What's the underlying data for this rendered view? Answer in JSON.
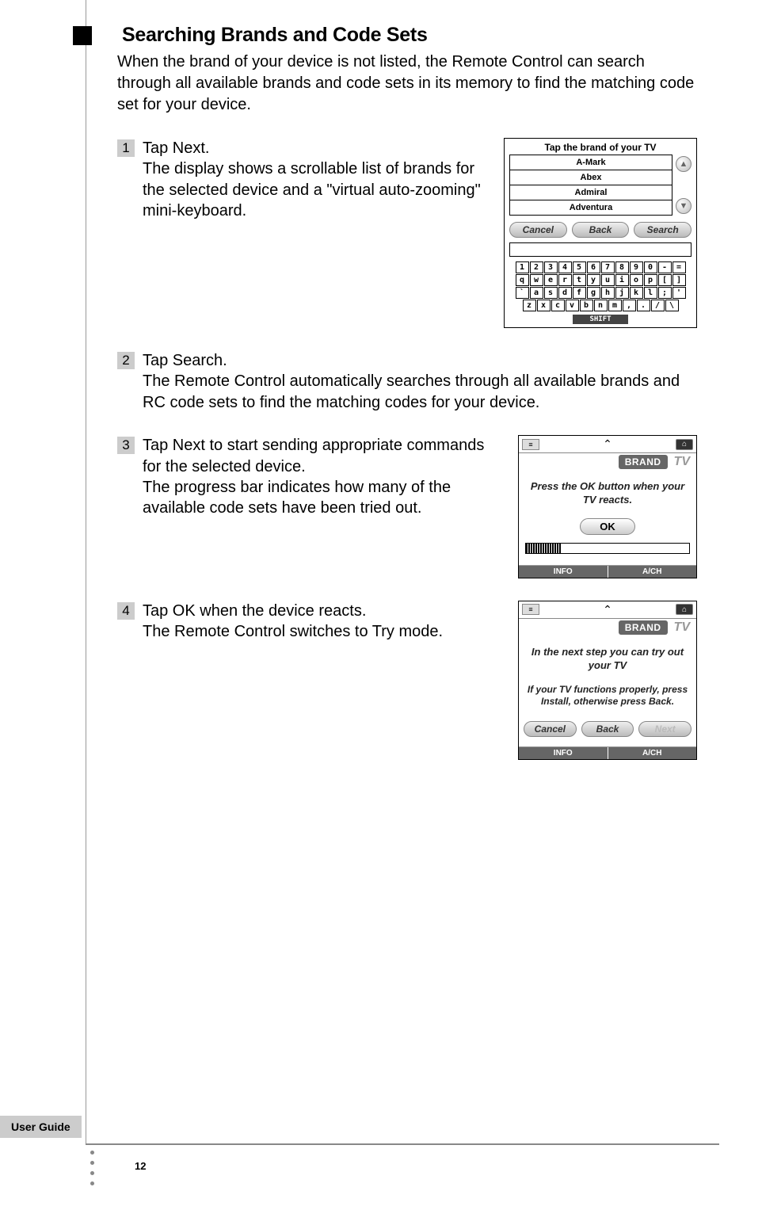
{
  "page": {
    "heading": "Searching Brands and Code Sets",
    "intro": "When the brand of your device is not listed, the Remote Control can search through all available brands and code sets in its memory to find the matching code set for your device.",
    "footer_label": "User Guide",
    "page_number": "12"
  },
  "steps": [
    {
      "num": "1",
      "title": "Tap Next.",
      "body": "The display shows a scrollable list of brands for the selected device and a \"virtual auto-zooming\" mini-keyboard."
    },
    {
      "num": "2",
      "title": "Tap Search.",
      "body": "The Remote Control automatically searches through all available brands and RC code sets to find the matching codes for your device."
    },
    {
      "num": "3",
      "title": "Tap Next to start sending appropriate commands for the selected device.",
      "body": "The progress bar indicates how many of the available code sets have been tried out."
    },
    {
      "num": "4",
      "title": "Tap OK when the device reacts.",
      "body": "The Remote Control switches to Try mode."
    }
  ],
  "screen1": {
    "title": "Tap the brand of your TV",
    "brands": [
      "A-Mark",
      "Abex",
      "Admiral",
      "Adventura"
    ],
    "buttons": {
      "cancel": "Cancel",
      "back": "Back",
      "search": "Search"
    },
    "shift": "SHIFT",
    "kbd": {
      "row1": [
        "1",
        "2",
        "3",
        "4",
        "5",
        "6",
        "7",
        "8",
        "9",
        "0",
        "-",
        "="
      ],
      "row2": [
        "q",
        "w",
        "e",
        "r",
        "t",
        "y",
        "u",
        "i",
        "o",
        "p",
        "[",
        "]"
      ],
      "row3": [
        "`",
        "a",
        "s",
        "d",
        "f",
        "g",
        "h",
        "j",
        "k",
        "l",
        ";",
        "'"
      ],
      "row4": [
        "z",
        "x",
        "c",
        "v",
        "b",
        "n",
        "m",
        ",",
        ".",
        "/",
        "\\"
      ]
    }
  },
  "screen2": {
    "brand_tab": "BRAND",
    "tv_tab": "TV",
    "message": "Press the OK button when your TV reacts.",
    "ok": "OK",
    "bottom": {
      "info": "INFO",
      "avch": "A/CH"
    }
  },
  "screen3": {
    "brand_tab": "BRAND",
    "tv_tab": "TV",
    "msg1": "In the next step you can try out your TV",
    "msg2": "If your TV functions properly, press Install, otherwise press Back.",
    "buttons": {
      "cancel": "Cancel",
      "back": "Back",
      "next": "Next"
    },
    "bottom": {
      "info": "INFO",
      "avch": "A/CH"
    }
  }
}
